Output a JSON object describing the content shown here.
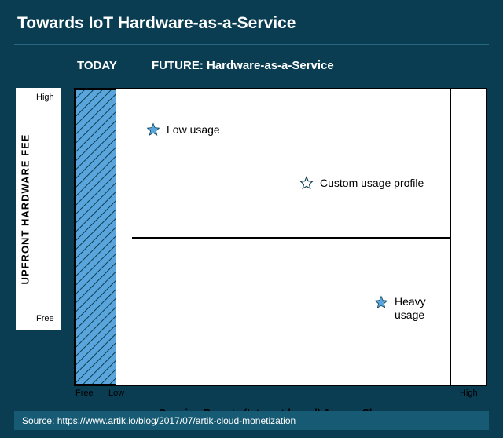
{
  "title": "Towards IoT Hardware-as-a-Service",
  "headers": {
    "today": "TODAY",
    "future": "FUTURE: Hardware-as-a-Service"
  },
  "y_axis": {
    "label": "UPFRONT HARDWARE FEE",
    "ticks": {
      "high": "High",
      "free": "Free"
    }
  },
  "x_axis": {
    "label": "Ongoing Remote (Internet-based) Access Charges",
    "ticks": {
      "free": "Free",
      "low": "Low",
      "high": "High"
    }
  },
  "points": {
    "low": {
      "label": "Low usage",
      "filled": true
    },
    "custom": {
      "label": "Custom usage profile",
      "filled": false
    },
    "heavy": {
      "label": "Heavy usage",
      "filled": true
    }
  },
  "source": "Source: https://www.artik.io/blog/2017/07/artik-cloud-monetization",
  "chart_data": {
    "type": "scatter",
    "title": "Towards IoT Hardware-as-a-Service",
    "xlabel": "Ongoing Remote (Internet-based) Access Charges",
    "ylabel": "Upfront Hardware Fee",
    "x_scale": [
      "Free",
      "Low",
      "High"
    ],
    "y_scale": [
      "Free",
      "High"
    ],
    "regions": [
      {
        "name": "TODAY",
        "x_range": [
          "Free",
          "Low"
        ],
        "y_range": [
          "Free",
          "High"
        ],
        "pattern": "hatch",
        "color": "#3f97d6"
      }
    ],
    "series": [
      {
        "name": "Low usage",
        "x": "Low",
        "y": "High",
        "marker": "star-filled"
      },
      {
        "name": "Custom usage profile",
        "x": "Mid-High",
        "y": "Mid",
        "marker": "star-outline"
      },
      {
        "name": "Heavy usage",
        "x": "High",
        "y": "Low",
        "marker": "star-filled"
      }
    ],
    "annotations": [
      "FUTURE: Hardware-as-a-Service region occupies x from Low to High"
    ]
  }
}
